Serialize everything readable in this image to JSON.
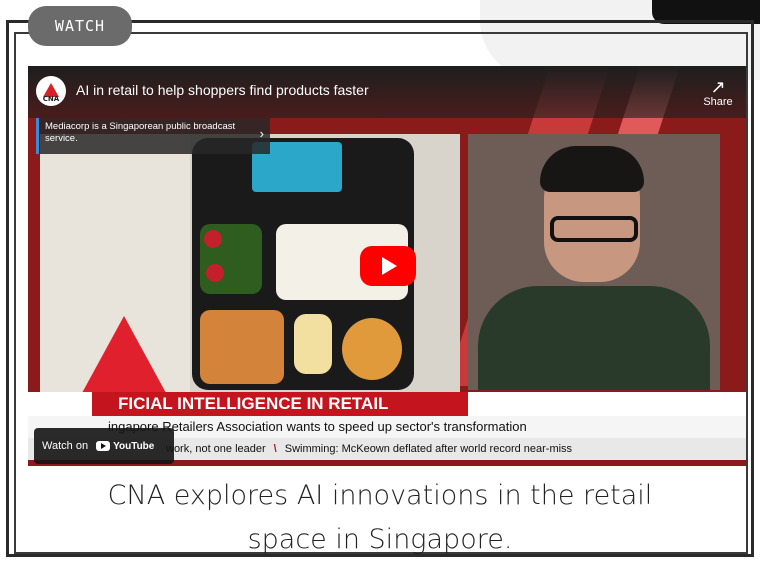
{
  "tag": {
    "label": "WATCH"
  },
  "video": {
    "title": "AI in retail to help shoppers find products faster",
    "channel_logo_text": "CNA",
    "share_label": "Share",
    "info_box": "Mediacorp is a Singaporean public broadcast service.",
    "headline": "FICIAL INTELLIGENCE IN RETAIL",
    "subline": "ingapore Retailers Association wants to speed up sector's transformation",
    "ticker": [
      "work, not one leader",
      "Swimming: McKeown deflated after world record near-miss"
    ],
    "watch_on": {
      "label": "Watch on",
      "platform": "YouTube"
    }
  },
  "caption": {
    "line1": "CNA explores AI innovations in the retail",
    "line2": "space in Singapore."
  },
  "colors": {
    "accent": "#c4151f",
    "youtube_red": "#ff0000",
    "info_border": "#3a8ad8"
  }
}
